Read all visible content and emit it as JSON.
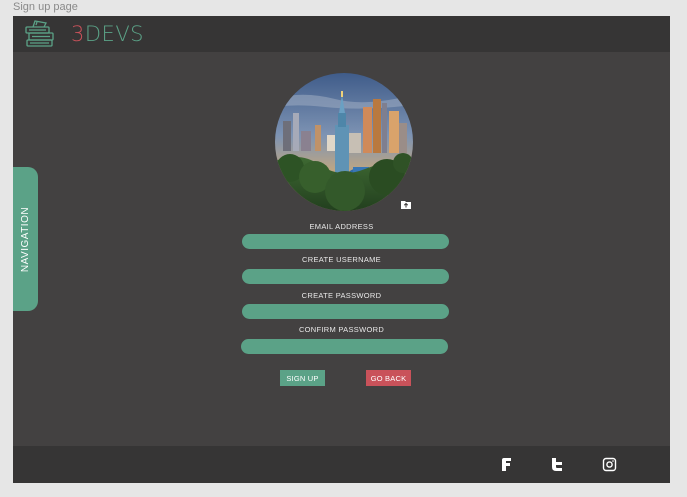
{
  "frame": {
    "label": "Sign up page"
  },
  "header": {
    "brand_number": "3",
    "brand_name": "DEVS",
    "logo_icon": "books-stack-icon"
  },
  "nav": {
    "label": "NAVIGATION"
  },
  "avatar": {
    "icon": "city-skyline-photo",
    "upload_icon": "folder-upload-icon"
  },
  "form": {
    "fields": [
      {
        "label": "EMAIL ADDRESS",
        "value": ""
      },
      {
        "label": "CREATE USERNAME",
        "value": ""
      },
      {
        "label": "CREATE PASSWORD",
        "value": ""
      },
      {
        "label": "CONFIRM PASSWORD",
        "value": ""
      }
    ],
    "signup_label": "SIGN UP",
    "back_label": "GO BACK"
  },
  "footer": {
    "icons": [
      "facebook-icon",
      "twitter-icon",
      "instagram-icon"
    ]
  },
  "colors": {
    "accent": "#5ba287",
    "danger": "#c9525a",
    "bg": "#434141",
    "bar": "#363535"
  }
}
